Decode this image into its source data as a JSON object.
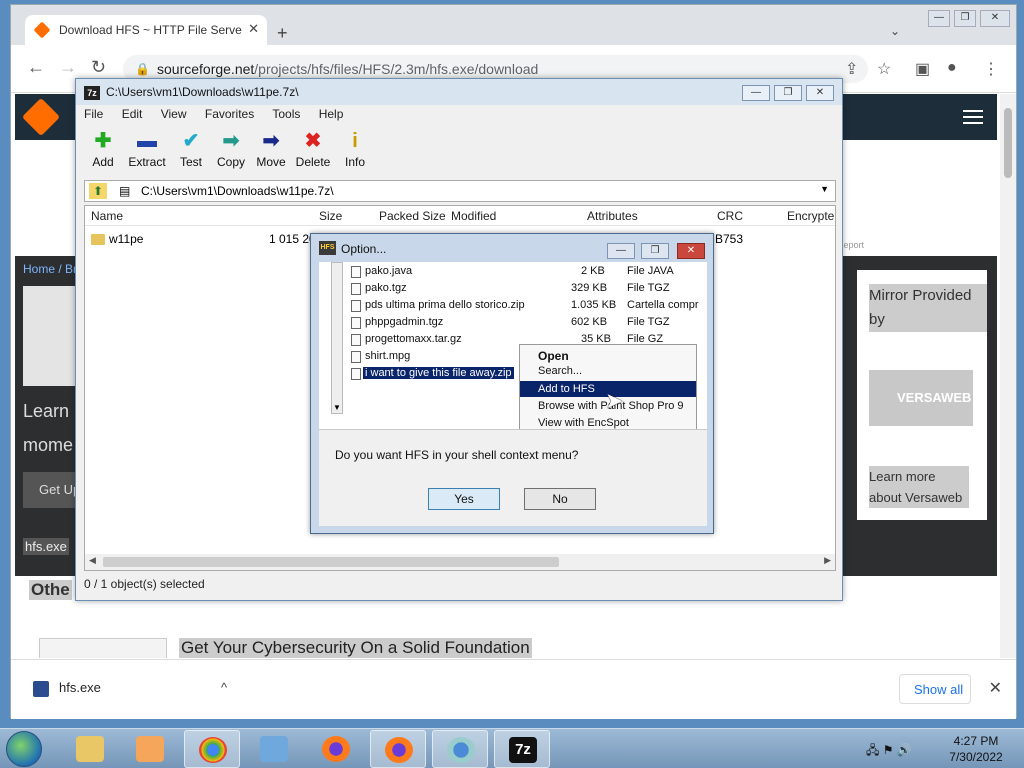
{
  "browser": {
    "tab_title": "Download HFS ~ HTTP File Serve",
    "url_domain": "sourceforge.net",
    "url_path": "/projects/hfs/files/HFS/2.3m/hfs.exe/download"
  },
  "page": {
    "breadcrumb": "Home / Br",
    "learn_text": "Learn mome",
    "get_button": "Get Up",
    "hfs_label": "hfs.exe",
    "mirror_title": "Mirror Provided by",
    "mirror_logo": "VERSAWEB",
    "mirror_more": "Learn more about Versaweb",
    "other_heading": "Othe",
    "banner": "Get Your Cybersecurity On a Solid Foundation",
    "report": "Report"
  },
  "downloads": {
    "file": "hfs.exe",
    "show_all": "Show all"
  },
  "sevenzip": {
    "title": "C:\\Users\\vm1\\Downloads\\w11pe.7z\\",
    "menu": [
      "File",
      "Edit",
      "View",
      "Favorites",
      "Tools",
      "Help"
    ],
    "toolbar": [
      "Add",
      "Extract",
      "Test",
      "Copy",
      "Move",
      "Delete",
      "Info"
    ],
    "address": "C:\\Users\\vm1\\Downloads\\w11pe.7z\\",
    "columns": [
      "Name",
      "Size",
      "Packed Size",
      "Modified",
      "Attributes",
      "CRC",
      "Encrypte"
    ],
    "row": {
      "name": "w11pe",
      "size": "1 015 20",
      "crc": "B753"
    },
    "status": "0 / 1 object(s) selected"
  },
  "dialog": {
    "title": "Option...",
    "files": [
      {
        "name": "pako.java",
        "size": "2 KB",
        "type": "File JAVA"
      },
      {
        "name": "pako.tgz",
        "size": "329 KB",
        "type": "File TGZ"
      },
      {
        "name": "pds ultima prima dello storico.zip",
        "size": "1.035 KB",
        "type": "Cartella compr"
      },
      {
        "name": "phppgadmin.tgz",
        "size": "602 KB",
        "type": "File TGZ"
      },
      {
        "name": "progettomaxx.tar.gz",
        "size": "35 KB",
        "type": "File GZ"
      },
      {
        "name": "shirt.mpg",
        "size": "",
        "type": ""
      },
      {
        "name": "i want to give this file away.zip",
        "size": "",
        "type": ""
      }
    ],
    "context_menu": [
      "Open",
      "Search...",
      "Add to HFS",
      "Browse with Paint Shop Pro 9",
      "View with EncSpot"
    ],
    "question": "Do you want HFS in your shell context menu?",
    "yes": "Yes",
    "no": "No"
  },
  "taskbar": {
    "time": "4:27 PM",
    "date": "7/30/2022",
    "apps": [
      "explorer",
      "media-player",
      "chrome",
      "control-panel",
      "firefox",
      "firefox",
      "hfs",
      "7zip"
    ]
  }
}
